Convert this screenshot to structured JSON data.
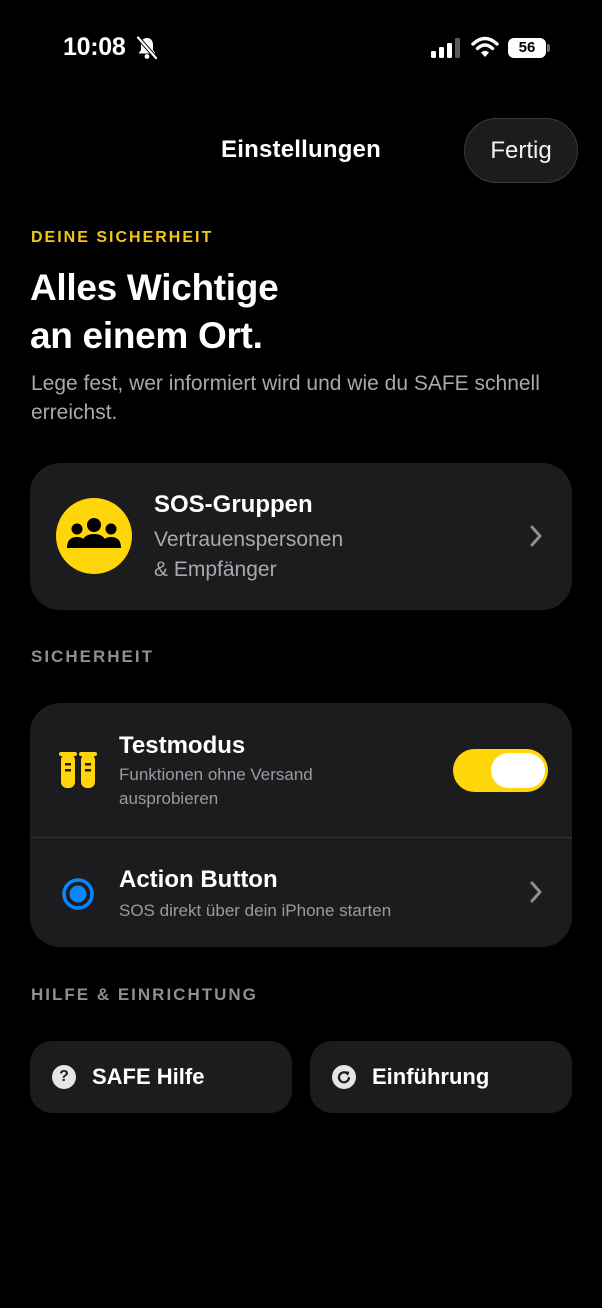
{
  "status_bar": {
    "time": "10:08",
    "battery": "56",
    "icons": [
      "bell-slash-icon",
      "cellular-signal-icon",
      "wifi-icon",
      "battery-icon"
    ]
  },
  "nav": {
    "title": "Einstellungen",
    "done_label": "Fertig"
  },
  "hero": {
    "eyebrow": "DEINE SICHERHEIT",
    "title_line1": "Alles Wichtige",
    "title_line2": "an einem Ort.",
    "subtitle": "Lege fest, wer informiert wird und wie du SAFE schnell erreichst."
  },
  "sos_card": {
    "icon": "people-group-icon",
    "title": "SOS-Gruppen",
    "subtitle_line1": "Vertrauenspersonen",
    "subtitle_line2": "& Empfänger"
  },
  "security": {
    "section_label": "SICHERHEIT",
    "rows": [
      {
        "icon": "test-tubes-icon",
        "title": "Testmodus",
        "subtitle_line1": "Funktionen ohne Versand",
        "subtitle_line2": "ausprobieren",
        "toggle_on": true
      },
      {
        "icon": "action-button-icon",
        "title": "Action Button",
        "subtitle": "SOS direkt über dein iPhone starten"
      }
    ]
  },
  "help": {
    "section_label": "HILFE & EINRICHTUNG",
    "buttons": [
      {
        "icon": "question-circle-icon",
        "glyph": "?",
        "label": "SAFE Hilfe"
      },
      {
        "icon": "replay-circle-icon",
        "label": "Einführung"
      }
    ]
  },
  "colors": {
    "background": "#000000",
    "card": "#1c1c1e",
    "accent_yellow": "#ffd60a",
    "eyebrow_yellow": "#f5c518",
    "action_blue": "#0a84ff",
    "secondary_text": "#a8a8ad"
  }
}
